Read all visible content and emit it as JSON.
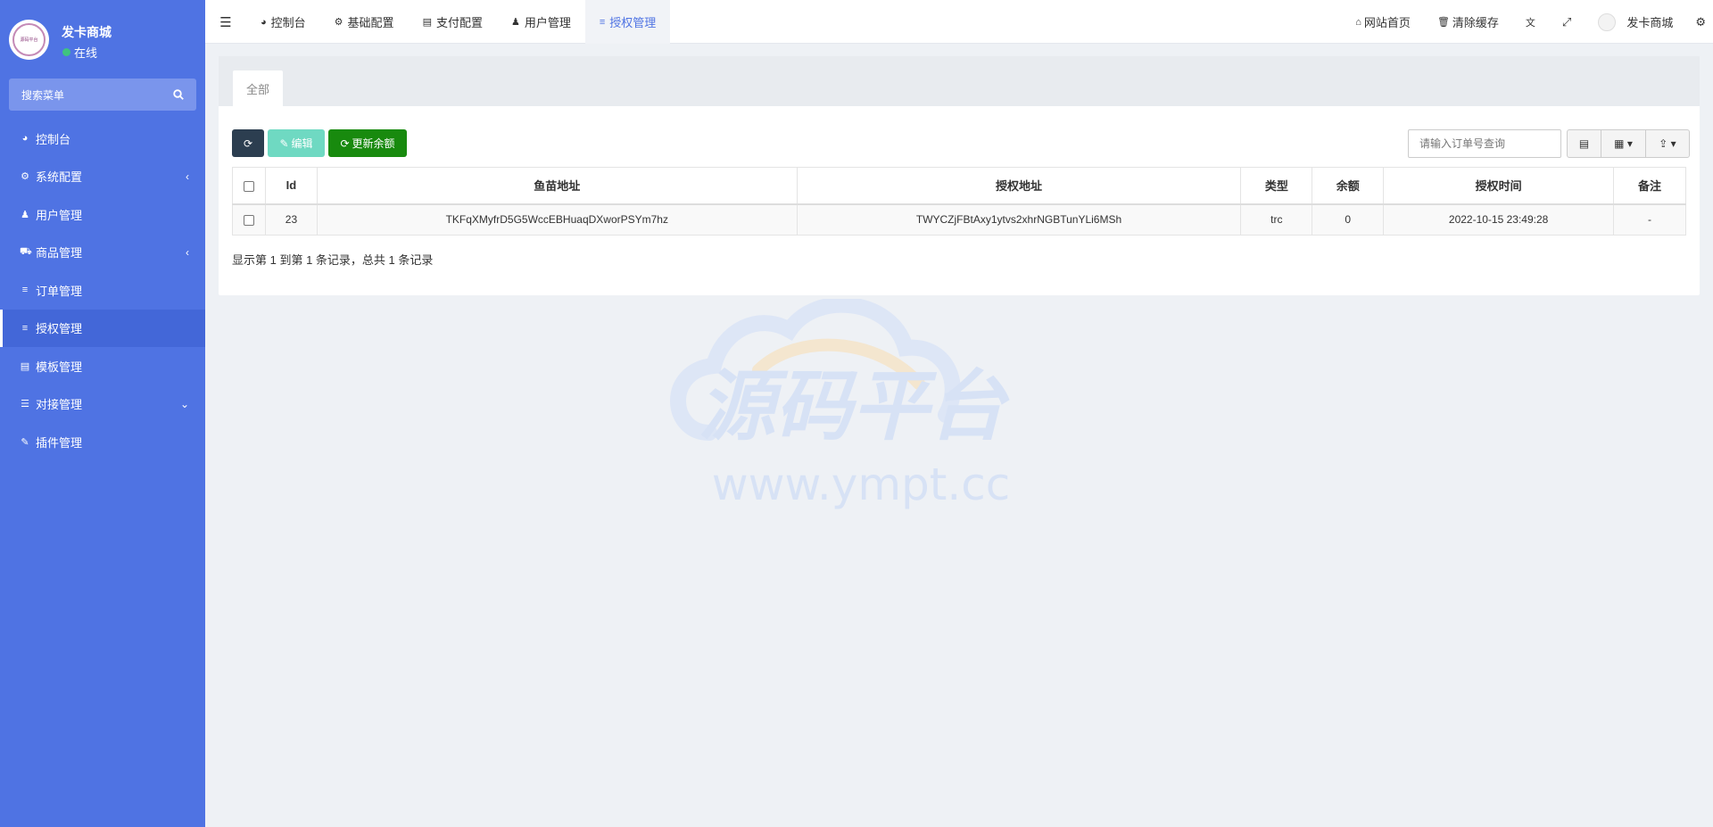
{
  "sidebar": {
    "user_name": "发卡商城",
    "status": "在线",
    "avatar_text": "源码平台",
    "search_placeholder": "搜索菜单",
    "menu": [
      {
        "label": "控制台",
        "icon": "dashboard-icon",
        "glyph": "◕",
        "caret": ""
      },
      {
        "label": "系统配置",
        "icon": "gear-icon",
        "glyph": "⚙",
        "caret": "‹"
      },
      {
        "label": "用户管理",
        "icon": "user-icon",
        "glyph": "♟",
        "caret": ""
      },
      {
        "label": "商品管理",
        "icon": "cart-icon",
        "glyph": "⛟",
        "caret": "‹"
      },
      {
        "label": "订单管理",
        "icon": "list-icon",
        "glyph": "≡",
        "caret": ""
      },
      {
        "label": "授权管理",
        "icon": "list-icon",
        "glyph": "≡",
        "caret": "",
        "active": true
      },
      {
        "label": "模板管理",
        "icon": "template-icon",
        "glyph": "▤",
        "caret": ""
      },
      {
        "label": "对接管理",
        "icon": "sliders-icon",
        "glyph": "☰",
        "caret": "⌄"
      },
      {
        "label": "插件管理",
        "icon": "plug-icon",
        "glyph": "✎",
        "caret": ""
      }
    ]
  },
  "topbar": {
    "tabs": [
      {
        "label": "控制台",
        "icon": "dashboard-icon",
        "glyph": "◕"
      },
      {
        "label": "基础配置",
        "icon": "gear-icon",
        "glyph": "⚙"
      },
      {
        "label": "支付配置",
        "icon": "server-icon",
        "glyph": "▤"
      },
      {
        "label": "用户管理",
        "icon": "user-icon",
        "glyph": "♟"
      },
      {
        "label": "授权管理",
        "icon": "list-icon",
        "glyph": "≡",
        "active": true
      }
    ],
    "home_label": "网站首页",
    "clear_cache_label": "清除缓存",
    "user_label": "发卡商城"
  },
  "panel": {
    "tab_all": "全部",
    "edit_label": "编辑",
    "update_balance_label": "更新余额",
    "search_placeholder": "请输入订单号查询",
    "columns": [
      "Id",
      "鱼苗地址",
      "授权地址",
      "类型",
      "余额",
      "授权时间",
      "备注"
    ],
    "rows": [
      {
        "id": "23",
        "fish_address": "TKFqXMyfrD5G5WccEBHuaqDXworPSYm7hz",
        "auth_address": "TWYCZjFBtAxy1ytvs2xhrNGBTunYLi6MSh",
        "type": "trc",
        "balance": "0",
        "auth_time": "2022-10-15 23:49:28",
        "note": "-"
      }
    ],
    "summary": "显示第 1 到第 1 条记录，总共 1 条记录"
  },
  "watermark": {
    "title": "源码平台",
    "url": "www.ympt.cc"
  },
  "colors": {
    "sidebar": "#4f73e3",
    "accent": "#4f73e3",
    "refresh_btn": "#2c3e50",
    "edit_btn": "#6fd9c2",
    "balance_btn": "#188a0e",
    "online": "#3fc380"
  }
}
